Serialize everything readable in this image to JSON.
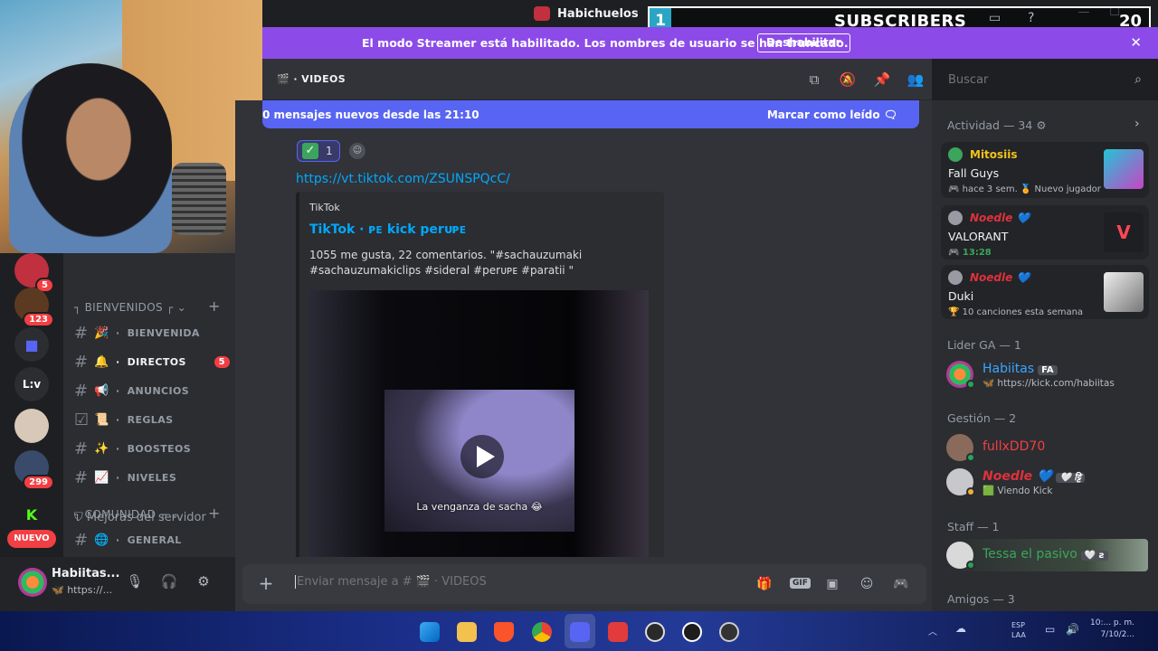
{
  "window": {
    "title": "Habichuelos"
  },
  "overlay": {
    "badge": "1",
    "label": "SUBSCRIBERS",
    "count": "20"
  },
  "banner": {
    "text": "El modo Streamer está habilitado. Los nombres de usuario se han truncado.",
    "button": "Deshabilitar"
  },
  "servers": {
    "badges": [
      "5",
      "123",
      "299"
    ],
    "lv_label": "L:v",
    "new_label": "NUEVO"
  },
  "sidebar": {
    "boost": "Mejoras del servidor",
    "categories": [
      {
        "name": "BIENVENIDOS"
      },
      {
        "name": "COMUNIDAD"
      }
    ],
    "channels": [
      {
        "name": "BIENVENIDA",
        "emoji": "🎉"
      },
      {
        "name": "DIRECTOS",
        "emoji": "🔔",
        "badge": "5"
      },
      {
        "name": "ANUNCIOS",
        "emoji": "📢"
      },
      {
        "name": "REGLAS",
        "emoji": "📜"
      },
      {
        "name": "BOOSTEOS",
        "emoji": "✨"
      },
      {
        "name": "NIVELES",
        "emoji": "📈"
      },
      {
        "name": "GENERAL",
        "emoji": "🌐"
      }
    ]
  },
  "user": {
    "name": "Habiitas...",
    "status": "🦋 https://..."
  },
  "chat": {
    "channel": "VIDEOS",
    "search_placeholder": "Buscar",
    "new_messages": "0 mensajes nuevos desde las 21:10",
    "mark_read": "Marcar como leído",
    "reaction_count": "1",
    "link": "https://vt.tiktok.com/ZSUNSPQcC/",
    "embed": {
      "provider": "TikTok",
      "title": "TikTok · ᴘᴇ kick perᴜᴘᴇ",
      "description": "1055 me gusta, 22 comentarios. \"#sachauzumaki #sachauzumakiclips #sideral #perᴜᴘᴇ #paratii \"",
      "video_caption": "La venganza de sacha 😂"
    },
    "composer_placeholder": "Enviar mensaje a # 🎬 · VIDEOS"
  },
  "members": {
    "activity_header": "Actividad — 34",
    "activities": [
      {
        "name": "Mitosiis",
        "game": "Fall Guys",
        "meta": "🎮 hace 3 sem.  🏅 Nuevo jugador",
        "color": "#f0c419"
      },
      {
        "name": "Noedle 💙",
        "game": "VALORANT",
        "meta": "🎮 13:28",
        "color": "#e0313b"
      },
      {
        "name": "Noedle 💙",
        "game": "Duki",
        "meta": "🏆 10 canciones esta semana",
        "color": "#e0313b"
      }
    ],
    "groups": [
      {
        "header": "Lider GA — 1",
        "members": [
          {
            "name": "Habiitas",
            "tag": "FA",
            "sub": "🦋 https://kick.com/habiitas",
            "color": "#3ba5ff"
          }
        ]
      },
      {
        "header": "Gestión — 2",
        "members": [
          {
            "name": "fullxDD70",
            "tag": "",
            "sub": "",
            "color": "#f23f43"
          },
          {
            "name": "Noedle 💙",
            "tag": "🤍 ट्टि",
            "sub": "🟩 Viendo Kick",
            "color": "#e0313b"
          }
        ]
      },
      {
        "header": "Staff — 1",
        "members": [
          {
            "name": "Tessa el pasivo",
            "tag": "🤍 ꙅ",
            "sub": "",
            "color": "#3ba55c"
          }
        ]
      },
      {
        "header": "Amigos — 3",
        "members": []
      }
    ]
  },
  "taskbar": {
    "tray_lang": "ESP",
    "tray_sub": "LAA",
    "clock_time": "10:... p. m.",
    "clock_date": "7/10/2..."
  }
}
